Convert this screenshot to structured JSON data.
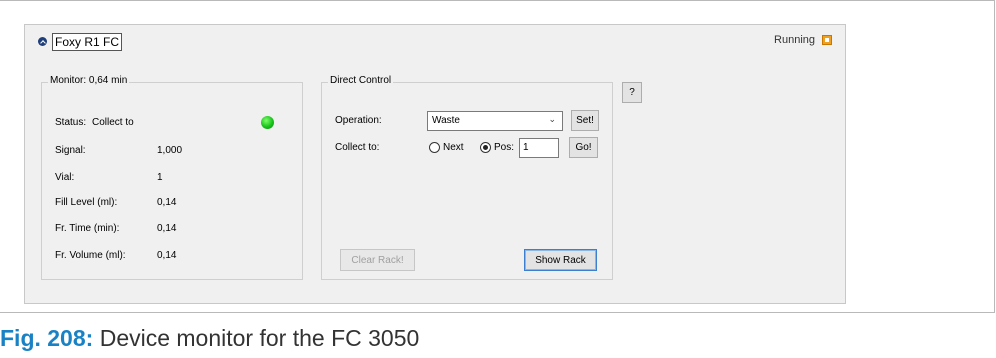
{
  "device": {
    "title": "Foxy R1 FC",
    "run_status": "Running"
  },
  "monitor": {
    "title": "Monitor: 0,64 min",
    "status_label": "Status:",
    "status_value": "Collect to",
    "status_led_color": "#17c21a",
    "rows": [
      {
        "label": "Signal:",
        "value": "1,000"
      },
      {
        "label": "Vial:",
        "value": "1"
      },
      {
        "label": "Fill Level (ml):",
        "value": "0,14"
      },
      {
        "label": "Fr. Time (min):",
        "value": "0,14"
      },
      {
        "label": "Fr. Volume (ml):",
        "value": "0,14"
      }
    ]
  },
  "direct_control": {
    "title": "Direct Control",
    "operation_label": "Operation:",
    "operation_value": "Waste",
    "set_button": "Set!",
    "collect_label": "Collect to:",
    "next_label": "Next",
    "pos_label": "Pos:",
    "pos_value": "1",
    "go_button": "Go!",
    "clear_rack_button": "Clear Rack!",
    "show_rack_button": "Show Rack"
  },
  "help_button": "?",
  "caption": {
    "fig_label": "Fig. 208:",
    "text": "Device monitor for the FC 3050"
  }
}
